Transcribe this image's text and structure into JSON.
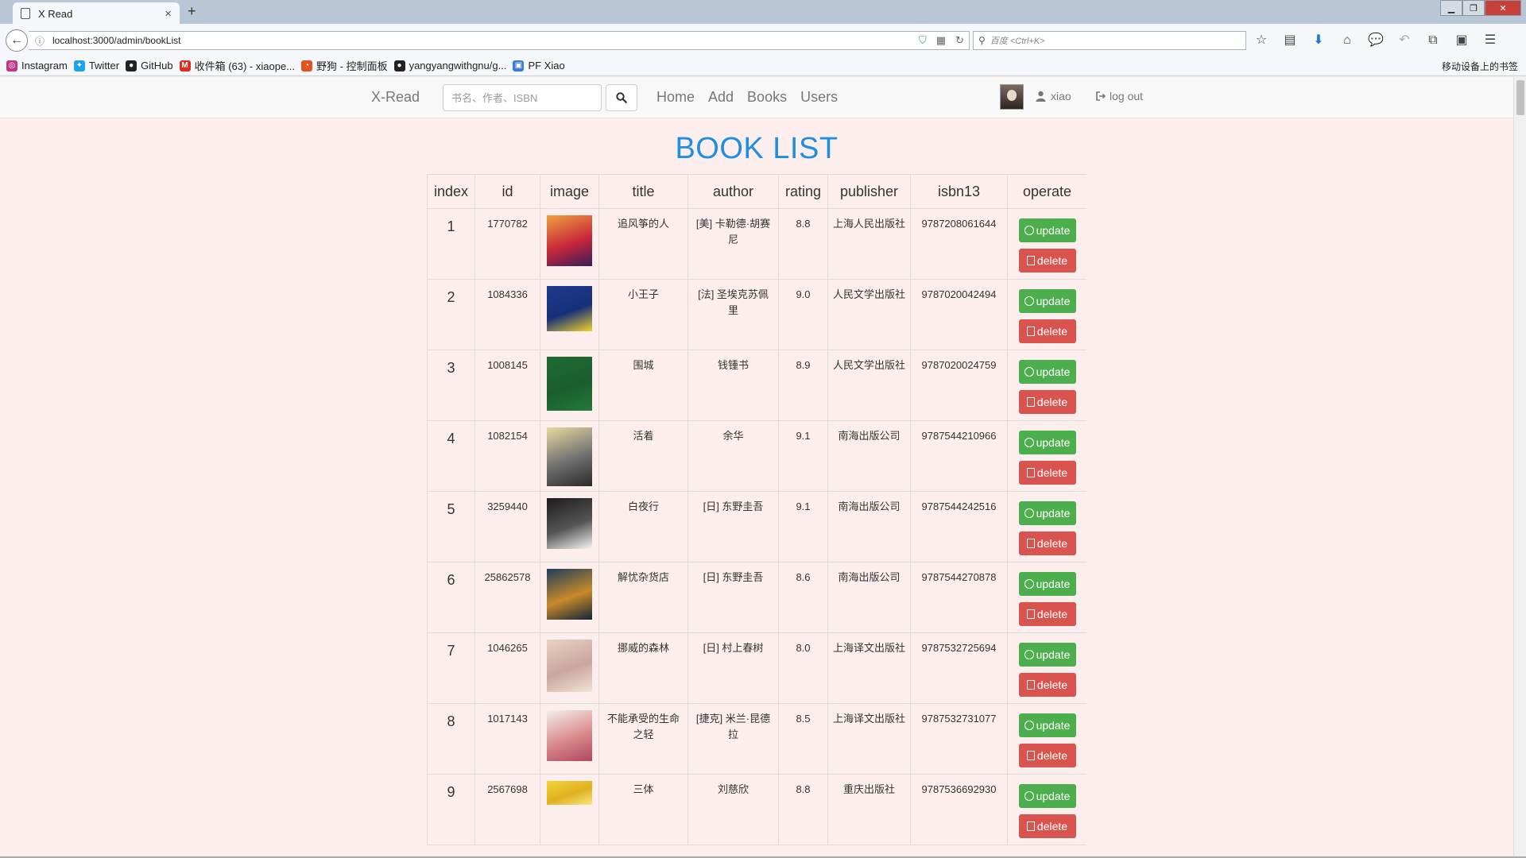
{
  "browser": {
    "tab_title": "X Read",
    "new_tab": "+",
    "url": "localhost:3000/admin/bookList",
    "search_placeholder": "百度 <Ctrl+K>",
    "bookmarks": [
      {
        "label": "Instagram",
        "color": "#c13584"
      },
      {
        "label": "Twitter",
        "color": "#1da1f2"
      },
      {
        "label": "GitHub",
        "color": "#222222"
      },
      {
        "label": "收件箱 (63) - xiaope...",
        "color": "#d93025"
      },
      {
        "label": "野狗 - 控制面板",
        "color": "#e2541b"
      },
      {
        "label": "yangyangwithgnu/g...",
        "color": "#222222"
      },
      {
        "label": "PF Xiao",
        "color": "#3a7bd5"
      }
    ],
    "mobile_bookmarks": "移动设备上的书签"
  },
  "navbar": {
    "brand": "X-Read",
    "search_placeholder": "书名、作者、ISBN",
    "links": [
      "Home",
      "Add",
      "Books",
      "Users"
    ],
    "username": "xiao",
    "logout": "log out"
  },
  "page": {
    "title": "BOOK LIST"
  },
  "table": {
    "headers": [
      "index",
      "id",
      "image",
      "title",
      "author",
      "rating",
      "publisher",
      "isbn13",
      "operate"
    ],
    "update_label": "update",
    "delete_label": "delete",
    "rows": [
      {
        "index": "1",
        "id": "1770782",
        "title": "追风筝的人",
        "author": "[美] 卡勒德·胡赛尼",
        "rating": "8.8",
        "publisher": "上海人民出版社",
        "isbn13": "9787208061644",
        "cover_colors": [
          "#f0a040",
          "#c8283a",
          "#3b1a5a"
        ]
      },
      {
        "index": "2",
        "id": "1084336",
        "title": "小王子",
        "author": "[法] 圣埃克苏佩里",
        "rating": "9.0",
        "publisher": "人民文学出版社",
        "isbn13": "9787020042494",
        "cover_colors": [
          "#1f3a8a",
          "#16307a",
          "#f2d12a"
        ]
      },
      {
        "index": "3",
        "id": "1008145",
        "title": "围城",
        "author": "钱锺书",
        "rating": "8.9",
        "publisher": "人民文学出版社",
        "isbn13": "9787020024759",
        "cover_colors": [
          "#1f6b34",
          "#1a5e2d",
          "#237a3b"
        ]
      },
      {
        "index": "4",
        "id": "1082154",
        "title": "活着",
        "author": "余华",
        "rating": "9.1",
        "publisher": "南海出版公司",
        "isbn13": "9787544210966",
        "cover_colors": [
          "#e8d9a0",
          "#6f6f70",
          "#2a2a2a"
        ]
      },
      {
        "index": "5",
        "id": "3259440",
        "title": "白夜行",
        "author": "[日] 东野圭吾",
        "rating": "9.1",
        "publisher": "南海出版公司",
        "isbn13": "9787544242516",
        "cover_colors": [
          "#1c1c1c",
          "#555555",
          "#f6f6f6"
        ]
      },
      {
        "index": "6",
        "id": "25862578",
        "title": "解忧杂货店",
        "author": "[日] 东野圭吾",
        "rating": "8.6",
        "publisher": "南海出版公司",
        "isbn13": "9787544270878",
        "cover_colors": [
          "#1d3d5c",
          "#c98a2a",
          "#122436"
        ]
      },
      {
        "index": "7",
        "id": "1046265",
        "title": "挪威的森林",
        "author": "[日] 村上春树",
        "rating": "8.0",
        "publisher": "上海译文出版社",
        "isbn13": "9787532725694",
        "cover_colors": [
          "#e8d2c0",
          "#c9a6a0",
          "#f1e3d6"
        ]
      },
      {
        "index": "8",
        "id": "1017143",
        "title": "不能承受的生命之轻",
        "author": "[捷克] 米兰·昆德拉",
        "rating": "8.5",
        "publisher": "上海译文出版社",
        "isbn13": "9787532731077",
        "cover_colors": [
          "#f4f0ee",
          "#d98a8a",
          "#b04660"
        ]
      },
      {
        "index": "9",
        "id": "2567698",
        "title": "三体",
        "author": "刘慈欣",
        "rating": "8.8",
        "publisher": "重庆出版社",
        "isbn13": "9787536692930",
        "cover_colors": [
          "#f3d43a",
          "#e0b020",
          "#f8e680"
        ]
      }
    ]
  }
}
